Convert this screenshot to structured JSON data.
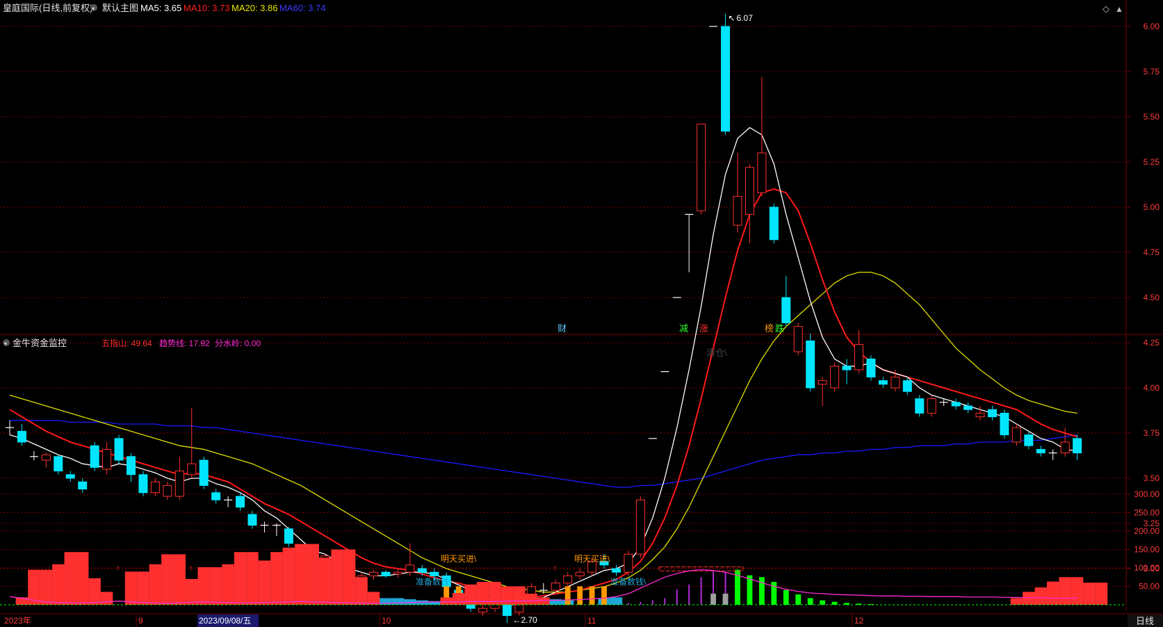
{
  "colors": {
    "bg": "#000000",
    "up": "#ff3030",
    "down": "#00e5ff",
    "ma5": "#ffffff",
    "ma10": "#ff1a1a",
    "ma20": "#e0e000",
    "ma60": "#1a1aff",
    "grid": "#7a0000",
    "axis_text": "#ff3b3b",
    "green_bar": "#00ff00",
    "orange_bar": "#ff9900",
    "blue_bar": "#1ea7d6",
    "purple": "#b22bd6",
    "magenta": "#ff2bd6",
    "gray_bar": "#a0a0a0"
  },
  "header": {
    "title": "皇庭国际(日线,前复权)",
    "indicator_name": "默认主图",
    "ma5_label": "MA5: 3.65",
    "ma10_label": "MA10: 3.73",
    "ma20_label": "MA20: 3.86",
    "ma60_label": "MA60: 3.74",
    "collapse_icon": "diamond-icon",
    "expand_icon": "caret-up-icon"
  },
  "price_axis": {
    "labels": [
      "6.00",
      "5.75",
      "5.50",
      "5.25",
      "5.00",
      "4.75",
      "4.50",
      "4.25",
      "4.00",
      "3.75",
      "3.50",
      "3.25",
      "3.00"
    ],
    "high_mark": "6.07",
    "low_mark": "2.70"
  },
  "event_tags": [
    {
      "text": "财",
      "color": "#5ec8ff"
    },
    {
      "text": "减",
      "color": "#2bff2b"
    },
    {
      "text": "涨",
      "color": "#ff3030"
    },
    {
      "text": "榜",
      "color": "#ff9900"
    },
    {
      "text": "跌",
      "color": "#2bff2b"
    }
  ],
  "sub_header": {
    "title": "金牛资金监控",
    "wuzhishan": "五指山: 49.64",
    "trend": "趋势线: 17.92",
    "water": "分水岭: 0.00",
    "faded_label": "清仓\\"
  },
  "sub_axis": {
    "labels": [
      "300.00",
      "250.00",
      "200.00",
      "150.00",
      "100.00",
      "50.00"
    ]
  },
  "annotations": {
    "buy_tomorrow_1": "明天买进\\",
    "buy_tomorrow_2": "明天买进\\",
    "prepare_1": "准备数钱\\",
    "prepare_2": "准备数钱\\"
  },
  "time_axis": {
    "labels": [
      "2023年",
      "9",
      "10",
      "11",
      "12"
    ],
    "cursor_date": "2023/09/08/五",
    "period_button": "日线"
  },
  "chart_data": {
    "type": "candlestick",
    "ylim": [
      2.7,
      6.07
    ],
    "candles": [
      {
        "o": 3.78,
        "h": 3.82,
        "l": 3.74,
        "c": 3.78
      },
      {
        "o": 3.76,
        "h": 3.8,
        "l": 3.68,
        "c": 3.7
      },
      {
        "o": 3.62,
        "h": 3.65,
        "l": 3.6,
        "c": 3.62
      },
      {
        "o": 3.6,
        "h": 3.64,
        "l": 3.56,
        "c": 3.63
      },
      {
        "o": 3.62,
        "h": 3.63,
        "l": 3.52,
        "c": 3.54
      },
      {
        "o": 3.52,
        "h": 3.54,
        "l": 3.48,
        "c": 3.5
      },
      {
        "o": 3.48,
        "h": 3.5,
        "l": 3.42,
        "c": 3.44
      },
      {
        "o": 3.68,
        "h": 3.7,
        "l": 3.54,
        "c": 3.56
      },
      {
        "o": 3.55,
        "h": 3.7,
        "l": 3.52,
        "c": 3.66
      },
      {
        "o": 3.72,
        "h": 3.74,
        "l": 3.58,
        "c": 3.6
      },
      {
        "o": 3.62,
        "h": 3.64,
        "l": 3.48,
        "c": 3.52
      },
      {
        "o": 3.52,
        "h": 3.54,
        "l": 3.4,
        "c": 3.42
      },
      {
        "o": 3.42,
        "h": 3.5,
        "l": 3.4,
        "c": 3.48
      },
      {
        "o": 3.4,
        "h": 3.48,
        "l": 3.38,
        "c": 3.46
      },
      {
        "o": 3.4,
        "h": 3.62,
        "l": 3.38,
        "c": 3.54
      },
      {
        "o": 3.52,
        "h": 3.89,
        "l": 3.5,
        "c": 3.58
      },
      {
        "o": 3.6,
        "h": 3.62,
        "l": 3.44,
        "c": 3.46
      },
      {
        "o": 3.42,
        "h": 3.44,
        "l": 3.36,
        "c": 3.38
      },
      {
        "o": 3.38,
        "h": 3.4,
        "l": 3.34,
        "c": 3.38
      },
      {
        "o": 3.4,
        "h": 3.42,
        "l": 3.32,
        "c": 3.34
      },
      {
        "o": 3.3,
        "h": 3.32,
        "l": 3.22,
        "c": 3.24
      },
      {
        "o": 3.24,
        "h": 3.26,
        "l": 3.2,
        "c": 3.24
      },
      {
        "o": 3.24,
        "h": 3.25,
        "l": 3.18,
        "c": 3.24
      },
      {
        "o": 3.22,
        "h": 3.23,
        "l": 3.12,
        "c": 3.14
      },
      {
        "o": 3.12,
        "h": 3.13,
        "l": 3.02,
        "c": 3.04
      },
      {
        "o": 3.04,
        "h": 3.08,
        "l": 3.02,
        "c": 3.06
      },
      {
        "o": 3.05,
        "h": 3.08,
        "l": 3.02,
        "c": 3.07
      },
      {
        "o": 3.04,
        "h": 3.06,
        "l": 2.96,
        "c": 2.98
      },
      {
        "o": 2.98,
        "h": 3.0,
        "l": 2.92,
        "c": 2.94
      },
      {
        "o": 2.92,
        "h": 2.98,
        "l": 2.9,
        "c": 2.96
      },
      {
        "o": 2.96,
        "h": 2.99,
        "l": 2.94,
        "c": 2.98
      },
      {
        "o": 2.98,
        "h": 2.99,
        "l": 2.95,
        "c": 2.96
      },
      {
        "o": 2.97,
        "h": 3.0,
        "l": 2.95,
        "c": 2.98
      },
      {
        "o": 2.98,
        "h": 3.14,
        "l": 2.96,
        "c": 3.02
      },
      {
        "o": 3.0,
        "h": 3.02,
        "l": 2.96,
        "c": 2.98
      },
      {
        "o": 2.98,
        "h": 3.0,
        "l": 2.94,
        "c": 2.96
      },
      {
        "o": 2.96,
        "h": 2.98,
        "l": 2.88,
        "c": 2.9
      },
      {
        "o": 2.88,
        "h": 2.9,
        "l": 2.84,
        "c": 2.86
      },
      {
        "o": 2.82,
        "h": 2.84,
        "l": 2.76,
        "c": 2.78
      },
      {
        "o": 2.76,
        "h": 2.8,
        "l": 2.74,
        "c": 2.78
      },
      {
        "o": 2.78,
        "h": 2.86,
        "l": 2.76,
        "c": 2.82
      },
      {
        "o": 2.82,
        "h": 2.84,
        "l": 2.7,
        "c": 2.74
      },
      {
        "o": 2.76,
        "h": 2.82,
        "l": 2.74,
        "c": 2.8
      },
      {
        "o": 2.84,
        "h": 2.92,
        "l": 2.82,
        "c": 2.9
      },
      {
        "o": 2.88,
        "h": 2.92,
        "l": 2.86,
        "c": 2.88
      },
      {
        "o": 2.88,
        "h": 2.94,
        "l": 2.86,
        "c": 2.92
      },
      {
        "o": 2.92,
        "h": 2.98,
        "l": 2.9,
        "c": 2.96
      },
      {
        "o": 2.96,
        "h": 3.0,
        "l": 2.94,
        "c": 2.98
      },
      {
        "o": 2.98,
        "h": 3.06,
        "l": 2.96,
        "c": 3.04
      },
      {
        "o": 3.04,
        "h": 3.08,
        "l": 3.0,
        "c": 3.02
      },
      {
        "o": 3.0,
        "h": 3.02,
        "l": 2.96,
        "c": 2.98
      },
      {
        "o": 2.98,
        "h": 3.1,
        "l": 2.96,
        "c": 3.08
      },
      {
        "o": 3.08,
        "h": 3.4,
        "l": 3.06,
        "c": 3.38
      },
      {
        "o": 3.72,
        "h": 3.72,
        "l": 3.72,
        "c": 3.72
      },
      {
        "o": 4.09,
        "h": 4.09,
        "l": 4.09,
        "c": 4.09
      },
      {
        "o": 4.5,
        "h": 4.5,
        "l": 4.5,
        "c": 4.5
      },
      {
        "o": 4.96,
        "h": 4.96,
        "l": 4.64,
        "c": 4.96
      },
      {
        "o": 4.98,
        "h": 5.46,
        "l": 4.96,
        "c": 5.46
      },
      {
        "o": 6.0,
        "h": 6.0,
        "l": 6.0,
        "c": 6.0
      },
      {
        "o": 6.0,
        "h": 6.07,
        "l": 5.4,
        "c": 5.42
      },
      {
        "o": 4.9,
        "h": 5.3,
        "l": 4.86,
        "c": 5.06
      },
      {
        "o": 4.96,
        "h": 5.24,
        "l": 4.8,
        "c": 5.22
      },
      {
        "o": 5.08,
        "h": 5.72,
        "l": 5.06,
        "c": 5.3
      },
      {
        "o": 5.0,
        "h": 5.02,
        "l": 4.8,
        "c": 4.82
      },
      {
        "o": 4.5,
        "h": 4.62,
        "l": 4.34,
        "c": 4.36
      },
      {
        "o": 4.2,
        "h": 4.36,
        "l": 4.18,
        "c": 4.34
      },
      {
        "o": 4.26,
        "h": 4.3,
        "l": 3.98,
        "c": 4.0
      },
      {
        "o": 4.02,
        "h": 4.06,
        "l": 3.9,
        "c": 4.04
      },
      {
        "o": 4.0,
        "h": 4.14,
        "l": 3.98,
        "c": 4.12
      },
      {
        "o": 4.12,
        "h": 4.16,
        "l": 4.02,
        "c": 4.1
      },
      {
        "o": 4.1,
        "h": 4.32,
        "l": 4.08,
        "c": 4.24
      },
      {
        "o": 4.16,
        "h": 4.18,
        "l": 4.04,
        "c": 4.06
      },
      {
        "o": 4.04,
        "h": 4.06,
        "l": 4.0,
        "c": 4.02
      },
      {
        "o": 4.0,
        "h": 4.1,
        "l": 3.98,
        "c": 4.06
      },
      {
        "o": 4.04,
        "h": 4.06,
        "l": 3.96,
        "c": 3.98
      },
      {
        "o": 3.94,
        "h": 3.96,
        "l": 3.84,
        "c": 3.86
      },
      {
        "o": 3.86,
        "h": 3.96,
        "l": 3.84,
        "c": 3.94
      },
      {
        "o": 3.92,
        "h": 3.94,
        "l": 3.9,
        "c": 3.92
      },
      {
        "o": 3.92,
        "h": 3.94,
        "l": 3.88,
        "c": 3.9
      },
      {
        "o": 3.9,
        "h": 3.92,
        "l": 3.86,
        "c": 3.88
      },
      {
        "o": 3.84,
        "h": 3.9,
        "l": 3.82,
        "c": 3.86
      },
      {
        "o": 3.88,
        "h": 3.9,
        "l": 3.82,
        "c": 3.84
      },
      {
        "o": 3.86,
        "h": 3.88,
        "l": 3.72,
        "c": 3.74
      },
      {
        "o": 3.7,
        "h": 3.8,
        "l": 3.68,
        "c": 3.78
      },
      {
        "o": 3.74,
        "h": 3.76,
        "l": 3.66,
        "c": 3.68
      },
      {
        "o": 3.66,
        "h": 3.68,
        "l": 3.62,
        "c": 3.64
      },
      {
        "o": 3.64,
        "h": 3.66,
        "l": 3.6,
        "c": 3.64
      },
      {
        "o": 3.64,
        "h": 3.78,
        "l": 3.62,
        "c": 3.7
      },
      {
        "o": 3.72,
        "h": 3.74,
        "l": 3.6,
        "c": 3.64
      }
    ],
    "ma5": [
      3.74,
      3.72,
      3.69,
      3.66,
      3.63,
      3.61,
      3.58,
      3.57,
      3.56,
      3.58,
      3.57,
      3.55,
      3.53,
      3.5,
      3.48,
      3.5,
      3.5,
      3.47,
      3.45,
      3.42,
      3.38,
      3.32,
      3.28,
      3.22,
      3.16,
      3.1,
      3.08,
      3.04,
      3.0,
      2.98,
      2.96,
      2.96,
      2.97,
      2.98,
      2.98,
      2.97,
      2.94,
      2.91,
      2.88,
      2.84,
      2.82,
      2.8,
      2.8,
      2.82,
      2.84,
      2.87,
      2.9,
      2.93,
      2.96,
      2.99,
      3.0,
      3.03,
      3.12,
      3.28,
      3.5,
      3.78,
      4.1,
      4.45,
      4.85,
      5.18,
      5.38,
      5.44,
      5.4,
      5.24,
      4.96,
      4.72,
      4.48,
      4.28,
      4.16,
      4.12,
      4.12,
      4.14,
      4.1,
      4.08,
      4.06,
      4.0,
      3.96,
      3.94,
      3.92,
      3.9,
      3.88,
      3.86,
      3.84,
      3.8,
      3.76,
      3.72,
      3.7,
      3.66,
      3.65
    ],
    "ma10": [
      3.88,
      3.84,
      3.8,
      3.76,
      3.73,
      3.7,
      3.68,
      3.66,
      3.64,
      3.62,
      3.6,
      3.58,
      3.56,
      3.54,
      3.52,
      3.53,
      3.52,
      3.5,
      3.48,
      3.44,
      3.4,
      3.36,
      3.33,
      3.3,
      3.26,
      3.22,
      3.18,
      3.14,
      3.1,
      3.06,
      3.03,
      3.01,
      3.0,
      2.99,
      2.97,
      2.95,
      2.93,
      2.92,
      2.9,
      2.88,
      2.86,
      2.85,
      2.84,
      2.84,
      2.85,
      2.86,
      2.87,
      2.88,
      2.9,
      2.92,
      2.94,
      2.98,
      3.04,
      3.14,
      3.28,
      3.46,
      3.68,
      3.94,
      4.22,
      4.5,
      4.76,
      4.96,
      5.08,
      5.1,
      5.08,
      4.98,
      4.8,
      4.6,
      4.42,
      4.28,
      4.2,
      4.14,
      4.1,
      4.08,
      4.06,
      4.04,
      4.02,
      4.0,
      3.98,
      3.96,
      3.94,
      3.92,
      3.9,
      3.88,
      3.84,
      3.8,
      3.77,
      3.75,
      3.73
    ],
    "ma20": [
      3.96,
      3.94,
      3.92,
      3.9,
      3.88,
      3.86,
      3.84,
      3.82,
      3.8,
      3.78,
      3.76,
      3.74,
      3.72,
      3.7,
      3.68,
      3.67,
      3.66,
      3.64,
      3.62,
      3.6,
      3.58,
      3.55,
      3.52,
      3.49,
      3.46,
      3.42,
      3.38,
      3.34,
      3.3,
      3.26,
      3.22,
      3.18,
      3.14,
      3.1,
      3.06,
      3.03,
      3.0,
      2.98,
      2.96,
      2.94,
      2.92,
      2.9,
      2.89,
      2.88,
      2.87,
      2.87,
      2.87,
      2.88,
      2.89,
      2.9,
      2.92,
      2.95,
      2.99,
      3.05,
      3.12,
      3.22,
      3.34,
      3.48,
      3.62,
      3.76,
      3.9,
      4.04,
      4.16,
      4.26,
      4.34,
      4.4,
      4.46,
      4.52,
      4.58,
      4.62,
      4.64,
      4.64,
      4.62,
      4.58,
      4.52,
      4.46,
      4.38,
      4.3,
      4.22,
      4.16,
      4.1,
      4.05,
      4.0,
      3.96,
      3.93,
      3.91,
      3.89,
      3.87,
      3.86
    ],
    "ma60": [
      3.82,
      3.82,
      3.82,
      3.82,
      3.82,
      3.81,
      3.81,
      3.81,
      3.81,
      3.8,
      3.8,
      3.8,
      3.8,
      3.79,
      3.79,
      3.79,
      3.78,
      3.78,
      3.77,
      3.76,
      3.75,
      3.74,
      3.73,
      3.72,
      3.71,
      3.7,
      3.69,
      3.68,
      3.67,
      3.66,
      3.65,
      3.64,
      3.63,
      3.62,
      3.61,
      3.6,
      3.59,
      3.58,
      3.57,
      3.56,
      3.55,
      3.54,
      3.53,
      3.52,
      3.51,
      3.5,
      3.49,
      3.48,
      3.47,
      3.46,
      3.45,
      3.45,
      3.46,
      3.46,
      3.47,
      3.48,
      3.49,
      3.5,
      3.52,
      3.54,
      3.56,
      3.58,
      3.6,
      3.61,
      3.62,
      3.63,
      3.63,
      3.64,
      3.64,
      3.65,
      3.65,
      3.66,
      3.66,
      3.67,
      3.67,
      3.68,
      3.68,
      3.68,
      3.69,
      3.69,
      3.7,
      3.7,
      3.7,
      3.71,
      3.71,
      3.71,
      3.72,
      3.73,
      3.74
    ],
    "sub_ylim": [
      0,
      350
    ],
    "sub_red_bars": [
      [
        1,
        20
      ],
      [
        2,
        95
      ],
      [
        3,
        95
      ],
      [
        4,
        110
      ],
      [
        5,
        143
      ],
      [
        6,
        143
      ],
      [
        7,
        72
      ],
      [
        8,
        35
      ],
      [
        10,
        90
      ],
      [
        11,
        90
      ],
      [
        12,
        110
      ],
      [
        13,
        137
      ],
      [
        14,
        137
      ],
      [
        15,
        70
      ],
      [
        16,
        102
      ],
      [
        17,
        102
      ],
      [
        18,
        110
      ],
      [
        19,
        143
      ],
      [
        20,
        143
      ],
      [
        21,
        120
      ],
      [
        22,
        143
      ],
      [
        23,
        155
      ],
      [
        24,
        165
      ],
      [
        25,
        165
      ],
      [
        26,
        128
      ],
      [
        27,
        150
      ],
      [
        28,
        150
      ],
      [
        29,
        75
      ],
      [
        30,
        35
      ],
      [
        36,
        20
      ],
      [
        37,
        32
      ],
      [
        38,
        55
      ],
      [
        39,
        62
      ],
      [
        40,
        62
      ],
      [
        41,
        50
      ],
      [
        42,
        50
      ],
      [
        43,
        30
      ],
      [
        44,
        20
      ],
      [
        83,
        18
      ],
      [
        84,
        35
      ],
      [
        85,
        47
      ],
      [
        86,
        63
      ],
      [
        87,
        75
      ],
      [
        88,
        75
      ],
      [
        89,
        60
      ],
      [
        90,
        60
      ]
    ],
    "sub_blue_bars": [
      [
        1,
        20
      ],
      [
        31,
        18
      ],
      [
        32,
        18
      ],
      [
        33,
        15
      ],
      [
        34,
        12
      ],
      [
        35,
        10
      ],
      [
        43,
        20
      ],
      [
        44,
        20
      ],
      [
        45,
        15
      ],
      [
        46,
        12
      ],
      [
        49,
        18
      ],
      [
        50,
        20
      ]
    ],
    "sub_orange_bars": [
      [
        36,
        50
      ],
      [
        37,
        50
      ],
      [
        46,
        50
      ],
      [
        47,
        50
      ],
      [
        48,
        50
      ],
      [
        49,
        50
      ]
    ],
    "sub_green_bars": [
      [
        60,
        95
      ],
      [
        61,
        80
      ],
      [
        62,
        75
      ],
      [
        63,
        62
      ],
      [
        64,
        40
      ],
      [
        65,
        28
      ],
      [
        66,
        18
      ],
      [
        67,
        12
      ],
      [
        68,
        8
      ],
      [
        69,
        5
      ],
      [
        70,
        3
      ],
      [
        71,
        2
      ]
    ],
    "sub_gray_bars": [
      [
        58,
        30
      ],
      [
        59,
        30
      ]
    ],
    "sub_purple_bars": [
      [
        51,
        5
      ],
      [
        52,
        8
      ],
      [
        53,
        12
      ],
      [
        54,
        18
      ],
      [
        55,
        42
      ],
      [
        56,
        55
      ],
      [
        57,
        75
      ],
      [
        58,
        90
      ],
      [
        59,
        90
      ]
    ],
    "sub_trend_line": [
      22,
      18,
      12,
      8,
      6,
      5,
      5,
      6,
      8,
      10,
      8,
      6,
      5,
      4,
      5,
      7,
      8,
      7,
      6,
      5,
      5,
      6,
      7,
      8,
      9,
      8,
      7,
      6,
      5,
      5,
      4,
      4,
      5,
      6,
      7,
      8,
      8,
      8,
      9,
      9,
      9,
      10,
      10,
      11,
      12,
      12,
      13,
      14,
      16,
      18,
      22,
      30,
      45,
      60,
      75,
      85,
      92,
      95,
      93,
      88,
      80,
      70,
      60,
      50,
      42,
      36,
      32,
      30,
      28,
      27,
      26,
      25,
      24,
      24,
      23,
      23,
      22,
      22,
      22,
      21,
      21,
      21,
      20,
      20,
      19,
      19,
      18,
      18,
      18
    ],
    "sub_baseline_arrows": [
      9,
      15,
      45
    ]
  }
}
